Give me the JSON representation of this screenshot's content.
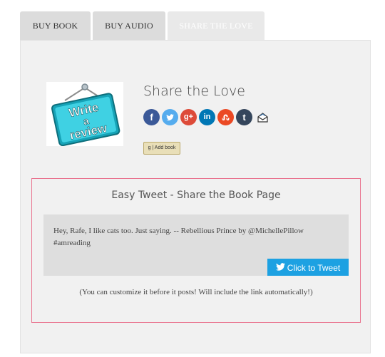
{
  "tabs": [
    {
      "label": "BUY BOOK",
      "active": false
    },
    {
      "label": "BUY AUDIO",
      "active": false
    },
    {
      "label": "SHARE THE LOVE",
      "active": true
    }
  ],
  "share": {
    "title": "Share the Love",
    "icons": [
      "facebook-icon",
      "twitter-icon",
      "google-plus-icon",
      "linkedin-icon",
      "stumbleupon-icon",
      "tumblr-icon",
      "email-icon"
    ],
    "review_image_text": [
      "Write",
      "a",
      "review"
    ],
    "add_book_label": "g | Add book"
  },
  "tweet": {
    "heading": "Easy Tweet - Share the Book Page",
    "quote": "Hey, Rafe, I like cats too. Just saying. -- Rebellious Prince by @MichellePillow #amreading",
    "button_label": "Click to Tweet",
    "note": "(You can customize it before it posts! Will include the link automatically!)"
  },
  "colors": {
    "facebook": "#3b5998",
    "twitter": "#55acee",
    "google_plus": "#dd4b39",
    "linkedin": "#0077b5",
    "stumbleupon": "#eb4924",
    "tumblr": "#35465c",
    "tweet_button": "#1da1e2",
    "box_border": "#e9738f"
  }
}
